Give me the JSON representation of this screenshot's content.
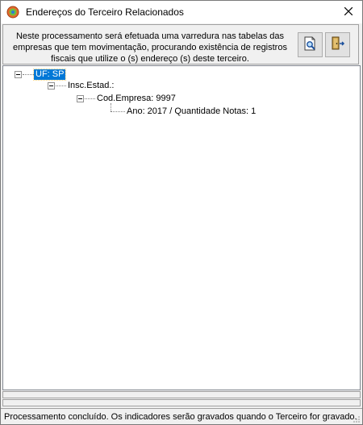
{
  "window": {
    "title": "Endereços do Terceiro Relacionados",
    "app_icon": "app-globe-icon",
    "close_icon": "close-icon"
  },
  "info": {
    "message": "Neste processamento será efetuada uma varredura nas tabelas das empresas que tem movimentação, procurando existência de registros fiscais que utilize o (s) endereço (s) deste terceiro."
  },
  "toolbar": {
    "search_icon": "document-search-icon",
    "exit_icon": "exit-door-icon"
  },
  "tree": {
    "root": {
      "label": "UF: SP",
      "selected": true,
      "expanded": true
    },
    "level1": {
      "label": "Insc.Estad.:",
      "expanded": true
    },
    "level2": {
      "label": "Cod.Empresa: 9997",
      "expanded": true
    },
    "level3": {
      "label": "Ano: 2017 / Quantidade Notas: 1"
    }
  },
  "status": {
    "message": "Processamento concluído. Os indicadores serão gravados quando o Terceiro for gravado."
  },
  "colors": {
    "selection": "#0078d7",
    "window_bg": "#f0f0f0"
  }
}
